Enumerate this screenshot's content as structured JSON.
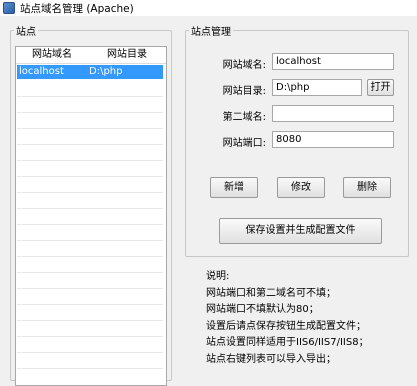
{
  "window": {
    "title": "站点域名管理 (Apache)"
  },
  "sites_panel": {
    "group_label": "站点",
    "columns": [
      "网站域名",
      "网站目录"
    ],
    "rows": [
      {
        "domain": "localhost",
        "directory": "D:\\php"
      }
    ]
  },
  "manage_panel": {
    "group_label": "站点管理",
    "domain_label": "网站域名:",
    "domain_value": "localhost",
    "directory_label": "网站目录:",
    "directory_value": "D:\\php",
    "open_button": "打开",
    "second_domain_label": "第二域名:",
    "second_domain_value": "",
    "port_label": "网站端口:",
    "port_value": "8080",
    "add_button": "新增",
    "modify_button": "修改",
    "delete_button": "删除",
    "save_button": "保存设置并生成配置文件"
  },
  "notes": {
    "title": "说明:",
    "lines": [
      "网站端口和第二域名可不填；",
      "网站端口不填默认为80；",
      "设置后请点保存按钮生成配置文件；",
      "站点设置同样适用于IIS6/IIS7/IIS8；",
      "站点右键列表可以导入导出；"
    ]
  }
}
